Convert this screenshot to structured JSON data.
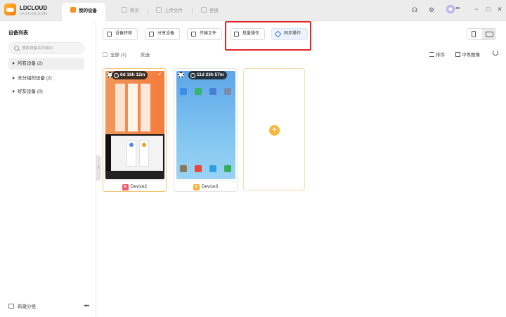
{
  "app": {
    "name": "LDCLOUD",
    "version": "LV.3.0.0(1.0.26)",
    "tabs": [
      {
        "label": "我的设备",
        "active": true
      },
      {
        "label": "购买",
        "active": false
      },
      {
        "label": "上传文件",
        "active": false
      },
      {
        "label": "更换",
        "active": false
      }
    ],
    "window_controls": {
      "minimize": "−",
      "maximize": "□",
      "close": "✕"
    },
    "titlebar_icons": [
      "headset-icon",
      "settings-icon",
      "avatar",
      "more-icon"
    ]
  },
  "sidebar": {
    "title": "设备列表",
    "search_placeholder": "搜索设备名称或ID",
    "groups": [
      {
        "label": "所有设备",
        "count": "(2)",
        "active": true
      },
      {
        "label": "未分组的设备",
        "count": "(2)",
        "active": false
      },
      {
        "label": "好友设备",
        "count": "(0)",
        "active": false
      }
    ],
    "new_group": "新建分组",
    "more": "•••",
    "collapse": "‹"
  },
  "toolbar": {
    "buttons": [
      "设备转移",
      "分享设备",
      "传输文件",
      "批量操作",
      "同步操作"
    ],
    "highlight_color": "#e02828"
  },
  "selection_bar": {
    "select_all": "全部",
    "count": "(1)",
    "invert": "反选",
    "sort": "排序",
    "view_size": "中等图像"
  },
  "devices": [
    {
      "name": "Device2",
      "timer": "6d 16h 12m",
      "badge": "K",
      "badge_color": "#f05a6e",
      "selected": true
    },
    {
      "name": "Device3",
      "timer": "11d 23h 57m",
      "badge": "X",
      "badge_color": "#f5b23c",
      "selected": false
    }
  ],
  "add_device": "+",
  "colors": {
    "accent": "#f7931e",
    "add": "#f7b63c",
    "sync_bg": "#eef4ff"
  }
}
